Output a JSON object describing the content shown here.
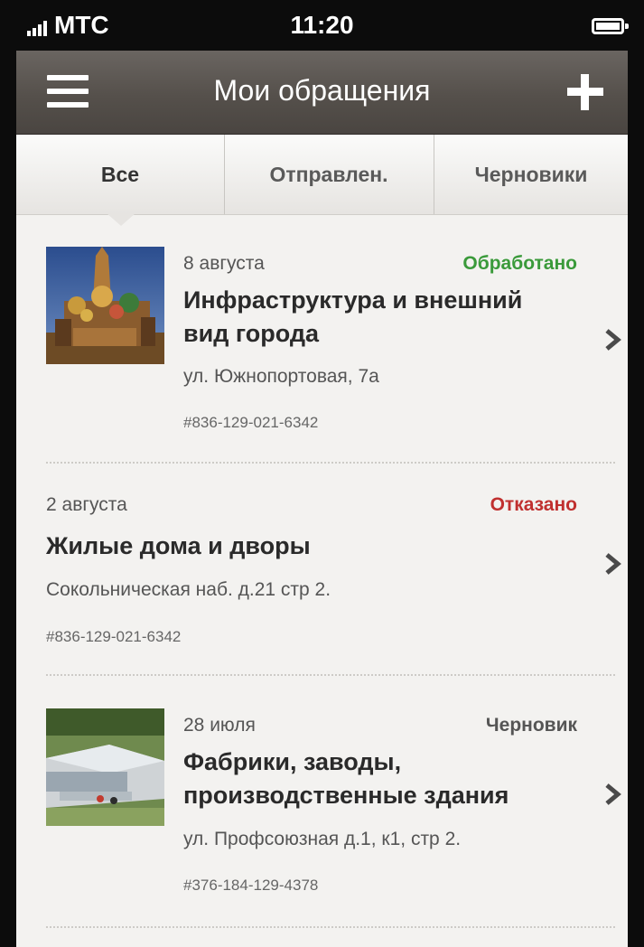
{
  "status_bar": {
    "carrier": "МТС",
    "time": "11:20"
  },
  "navbar": {
    "title": "Мои обращения",
    "menu_icon": "hamburger-menu-icon",
    "add_icon": "plus-icon"
  },
  "tabs": [
    {
      "label": "Все",
      "selected": true
    },
    {
      "label": "Отправлен.",
      "selected": false
    },
    {
      "label": "Черновики",
      "selected": false
    }
  ],
  "items": [
    {
      "date": "8 августа",
      "status": "Обработано",
      "status_color": "#3a9a3a",
      "title_line1": "Инфраструктура и внешний",
      "title_line2": "вид города",
      "address": "ул. Южнопортовая, 7а",
      "number": "#836-129-021-6342",
      "has_photo": true
    },
    {
      "date": "2 августа",
      "status": "Отказано",
      "status_color": "#c0302f",
      "title_line1": "Жилые дома и дворы",
      "address": "Сокольническая наб. д.21 стр 2.",
      "number": "#836-129-021-6342",
      "has_photo": false
    },
    {
      "date": "28 июля",
      "status": "Черновик",
      "status_color": "#555555",
      "title_line1": "Фабрики, заводы,",
      "title_line2": "производственные здания",
      "address": "ул. Профсоюзная д.1, к1, стр 2.",
      "number": "#376-184-129-4378",
      "has_photo": true
    }
  ]
}
